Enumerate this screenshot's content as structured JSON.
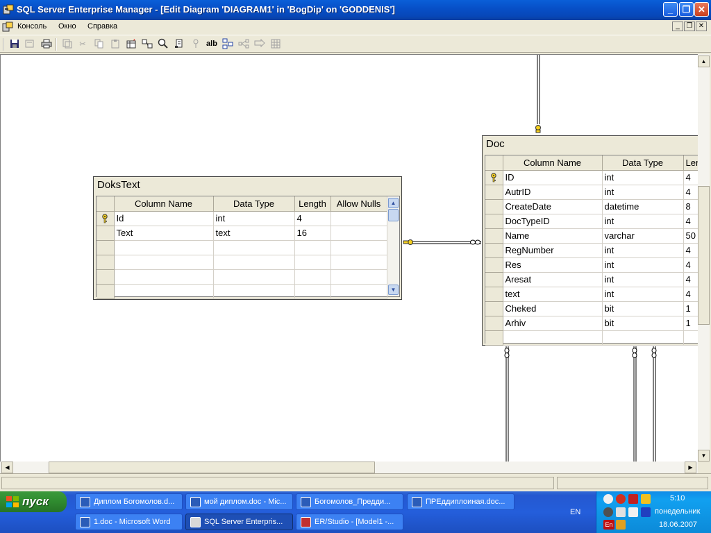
{
  "window": {
    "title": "SQL Server Enterprise Manager - [Edit Diagram 'DIAGRAM1' in 'BogDip' on 'GODDENIS']",
    "minimize": "_",
    "maximize": "❐",
    "close": "✕"
  },
  "menu": {
    "items": [
      "Консоль",
      "Окно",
      "Справка"
    ]
  },
  "toolbar": {
    "text_tool": "alb"
  },
  "tables": {
    "dokstext": {
      "name": "DoksText",
      "headers": [
        "Column Name",
        "Data Type",
        "Length",
        "Allow Nulls"
      ],
      "rows": [
        {
          "key": true,
          "name": "Id",
          "type": "int",
          "length": "4"
        },
        {
          "key": false,
          "name": "Text",
          "type": "text",
          "length": "16"
        }
      ]
    },
    "doc": {
      "name": "Doc",
      "headers": [
        "Column Name",
        "Data Type",
        "Len"
      ],
      "rows": [
        {
          "key": true,
          "name": "ID",
          "type": "int",
          "length": "4"
        },
        {
          "key": false,
          "name": "AutrID",
          "type": "int",
          "length": "4"
        },
        {
          "key": false,
          "name": "CreateDate",
          "type": "datetime",
          "length": "8"
        },
        {
          "key": false,
          "name": "DocTypeID",
          "type": "int",
          "length": "4"
        },
        {
          "key": false,
          "name": "Name",
          "type": "varchar",
          "length": "50"
        },
        {
          "key": false,
          "name": "RegNumber",
          "type": "int",
          "length": "4"
        },
        {
          "key": false,
          "name": "Res",
          "type": "int",
          "length": "4"
        },
        {
          "key": false,
          "name": "Aresat",
          "type": "int",
          "length": "4"
        },
        {
          "key": false,
          "name": "text",
          "type": "int",
          "length": "4"
        },
        {
          "key": false,
          "name": "Cheked",
          "type": "bit",
          "length": "1"
        },
        {
          "key": false,
          "name": "Arhiv",
          "type": "bit",
          "length": "1"
        }
      ]
    }
  },
  "taskbar": {
    "start": "пуск",
    "tasks_row1": [
      "Диплом Богомолов.d...",
      "мой диплом.doc - Mic...",
      "Богомолов_Предди...",
      "ПРЕддиплоиная.doc..."
    ],
    "tasks_row2": [
      "1.doc - Microsoft Word",
      "SQL Server Enterpris...",
      "ER/Studio - [Model1 -..."
    ],
    "lang": "EN",
    "time": "5:10",
    "day": "понедельник",
    "date": "18.06.2007",
    "tray_lang": "En"
  }
}
